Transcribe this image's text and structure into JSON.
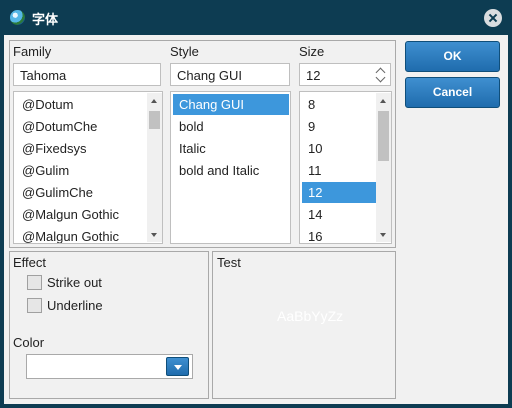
{
  "window": {
    "title": "字体"
  },
  "family": {
    "label": "Family",
    "value": "Tahoma",
    "items": [
      "@Dotum",
      "@DotumChe",
      "@Fixedsys",
      "@Gulim",
      "@GulimChe",
      "@Malgun Gothic",
      "@Malgun Gothic"
    ]
  },
  "style": {
    "label": "Style",
    "value": "Chang GUI",
    "items": [
      "Chang GUI",
      "bold",
      "Italic",
      "bold and Italic"
    ],
    "selected": "Chang GUI"
  },
  "size": {
    "label": "Size",
    "value": "12",
    "items": [
      "8",
      "9",
      "10",
      "11",
      "12",
      "14",
      "16"
    ],
    "selected": "12"
  },
  "buttons": {
    "ok": "OK",
    "cancel": "Cancel"
  },
  "effect": {
    "label": "Effect",
    "strike_out": "Strike out",
    "underline": "Underline",
    "color_label": "Color"
  },
  "test": {
    "label": "Test",
    "preview_text": "AaBbYyZz"
  },
  "colors": {
    "titlebar": "#0d3c52",
    "accent": "#3d97dc",
    "button": "#2a7fc0"
  },
  "icons": {
    "app": "globe-icon",
    "close": "close-icon"
  }
}
